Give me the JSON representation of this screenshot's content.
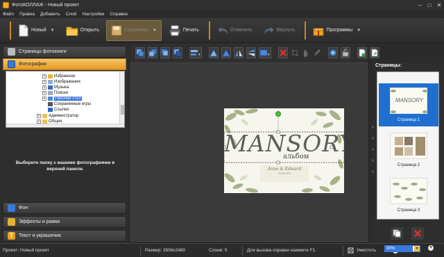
{
  "app": {
    "title": "ФотоКОЛЛАЖ - Новый проект"
  },
  "menu": {
    "items": [
      "Файл",
      "Правка",
      "Добавить",
      "Слой",
      "Настройки",
      "Справка"
    ]
  },
  "toolbar": {
    "new_label": "Новый",
    "open_label": "Открыть",
    "save_label": "Сохранить",
    "print_label": "Печать",
    "undo_label": "Отменить",
    "redo_label": "Вернуть",
    "programs_label": "Программы"
  },
  "left_panel": {
    "tabs": {
      "pages": "Страницы фотокниги",
      "photos": "Фотографии",
      "background": "Фон",
      "effects": "Эффекты и рамки",
      "text": "Текст и украшения"
    },
    "tree": [
      {
        "label": "Избранное",
        "icon": "star-icon"
      },
      {
        "label": "Изображения",
        "icon": "images-icon"
      },
      {
        "label": "Музыка",
        "icon": "music-icon"
      },
      {
        "label": "Поиски",
        "icon": "search-icon"
      },
      {
        "label": "Рабочий стол",
        "icon": "desktop-icon",
        "selected": true
      },
      {
        "label": "Сохраненные игры",
        "icon": "games-icon"
      },
      {
        "label": "Ссылки",
        "icon": "links-icon"
      },
      {
        "label": "Администратор",
        "icon": "folder-icon"
      },
      {
        "label": "Общие",
        "icon": "folder-icon"
      }
    ],
    "hint": "Выберите папку с вашими фотографиями в верхней панели."
  },
  "canvas": {
    "headline": "MANSORY",
    "subtitle": "альбом",
    "names": "Anna & Edward",
    "date": "20.05.2023"
  },
  "right_panel": {
    "title": "Страницы:",
    "pages": [
      {
        "label": "Страница 1",
        "selected": true
      },
      {
        "label": "Страница 2",
        "selected": false
      },
      {
        "label": "Страница 3",
        "selected": false
      }
    ]
  },
  "status": {
    "project": "Проект:  Новый проект",
    "size": "Размер:  3508x2480",
    "layers": "Слоев:  5",
    "help": "Для вызова справки нажмите F1.",
    "fit": "Уместить",
    "zoom": "30%"
  },
  "colors": {
    "accent": "#e59a22",
    "selection": "#1f6fd1"
  }
}
